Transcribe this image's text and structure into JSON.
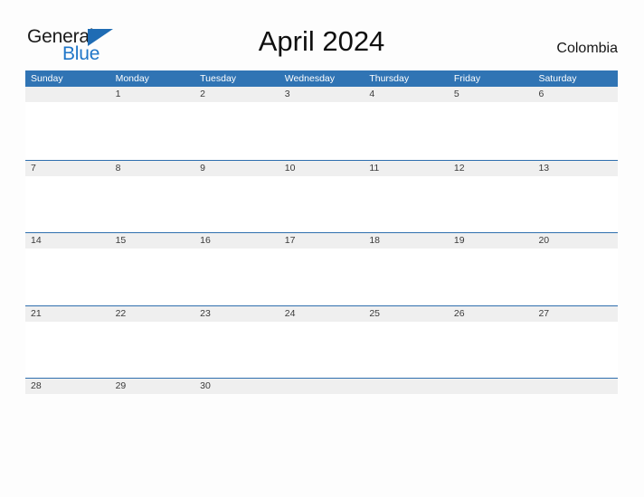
{
  "brand": {
    "name_part1": "General",
    "name_part2": "Blue",
    "flag_icon": "triangle-flag-icon",
    "accent_color": "#1f76c8"
  },
  "header": {
    "title": "April 2024",
    "location": "Colombia"
  },
  "colors": {
    "header_blue": "#3074b4",
    "rule_blue": "#2f6fae",
    "band_gray": "#efefef",
    "page_background": "#fdfdfd",
    "date_text": "#3a3a3a"
  },
  "calendar": {
    "month": "April",
    "year": "2024",
    "weekday_headers": [
      "Sunday",
      "Monday",
      "Tuesday",
      "Wednesday",
      "Thursday",
      "Friday",
      "Saturday"
    ],
    "weeks": [
      [
        "",
        "1",
        "2",
        "3",
        "4",
        "5",
        "6"
      ],
      [
        "7",
        "8",
        "9",
        "10",
        "11",
        "12",
        "13"
      ],
      [
        "14",
        "15",
        "16",
        "17",
        "18",
        "19",
        "20"
      ],
      [
        "21",
        "22",
        "23",
        "24",
        "25",
        "26",
        "27"
      ],
      [
        "28",
        "29",
        "30",
        "",
        "",
        "",
        ""
      ]
    ]
  }
}
